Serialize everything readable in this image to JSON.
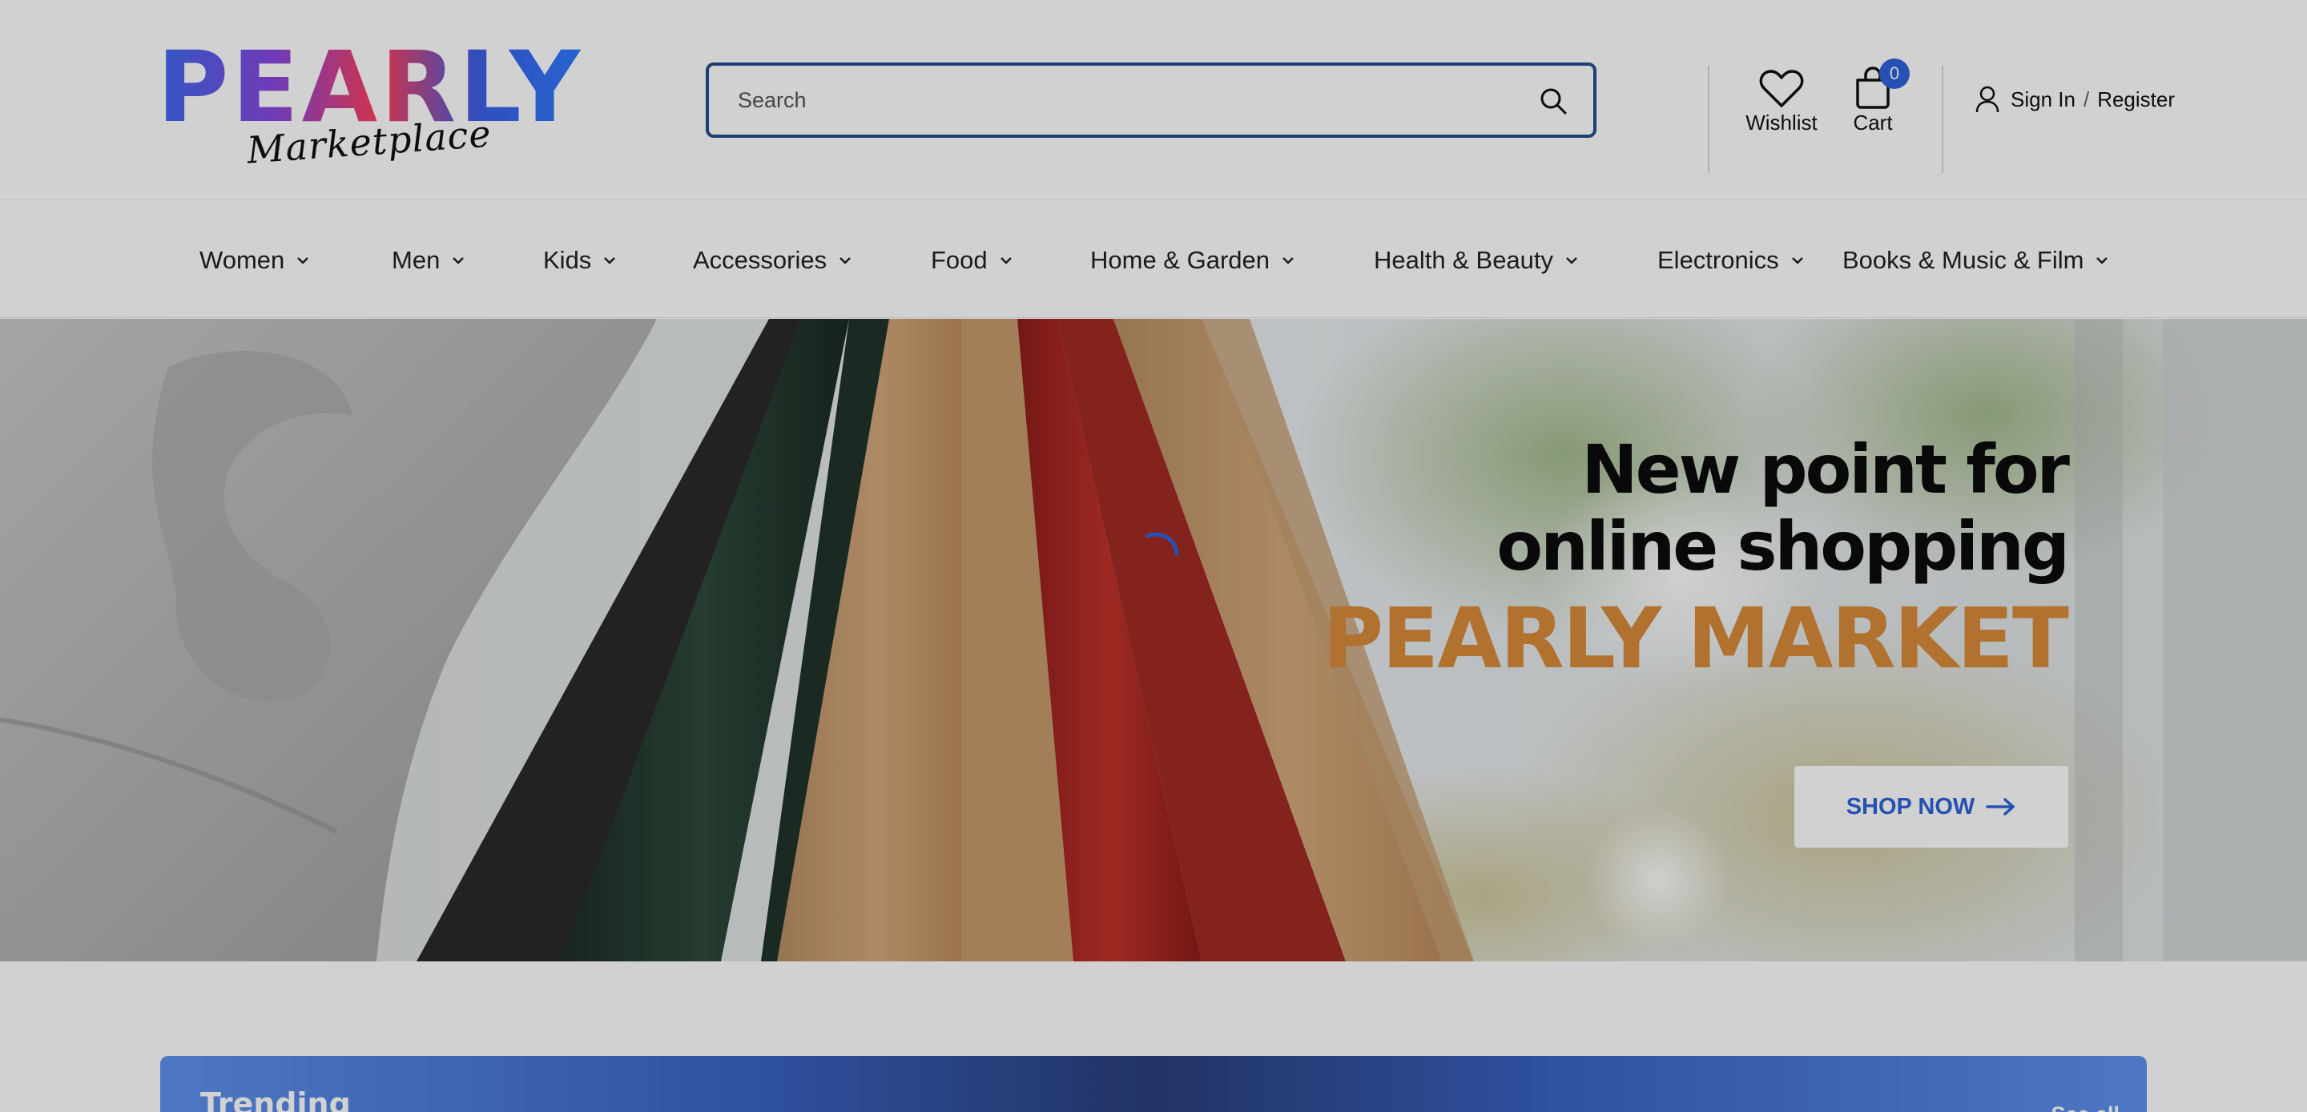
{
  "brand": {
    "logo_text": "PEARLY",
    "logo_subtext": "Marketplace"
  },
  "search": {
    "placeholder": "Search",
    "icon": "search-icon"
  },
  "header_actions": {
    "wishlist_label": "Wishlist",
    "cart_label": "Cart",
    "cart_count": "0",
    "sign_in_label": "Sign In",
    "separator": "/",
    "register_label": "Register"
  },
  "nav": {
    "items": [
      {
        "label": "Women"
      },
      {
        "label": "Men"
      },
      {
        "label": "Kids"
      },
      {
        "label": "Accessories"
      },
      {
        "label": "Food"
      },
      {
        "label": "Home & Garden"
      },
      {
        "label": "Health & Beauty"
      },
      {
        "label": "Electronics"
      },
      {
        "label": "Books & Music & Film"
      }
    ]
  },
  "hero": {
    "title_line1": "New point for",
    "title_line2": "online shopping",
    "brand_line": "PEARLY MARKET",
    "cta_label": "SHOP NOW"
  },
  "trending": {
    "title": "Trending",
    "see_all_label": "See all"
  },
  "colors": {
    "accent_blue": "#2f63d9",
    "search_border": "#274e8c",
    "hero_brand_orange": "#d88a3a",
    "overlay": "rgba(0,0,0,0.18)"
  }
}
